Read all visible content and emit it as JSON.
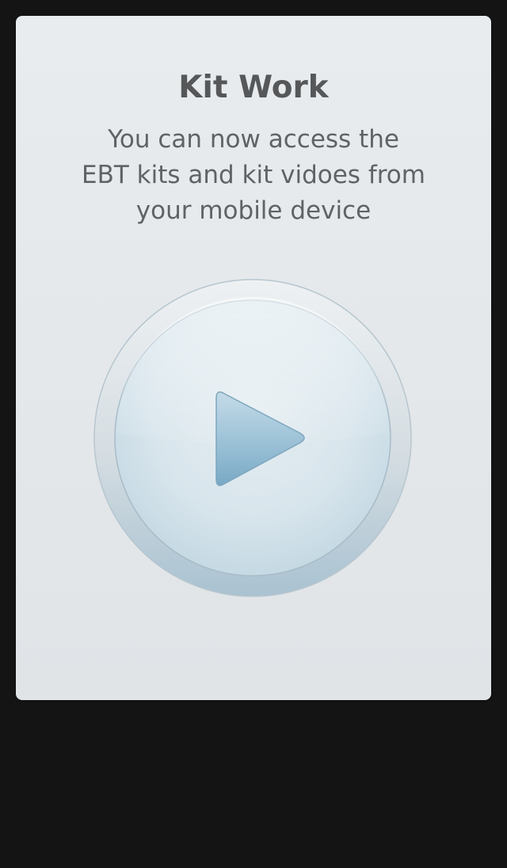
{
  "card": {
    "title": "Kit Work",
    "description_lines": [
      "You can now access the",
      "EBT kits and kit vidoes from",
      "your mobile device"
    ]
  },
  "play_button": {
    "icon": "play-icon",
    "accent_color": "#7fb0cc"
  }
}
